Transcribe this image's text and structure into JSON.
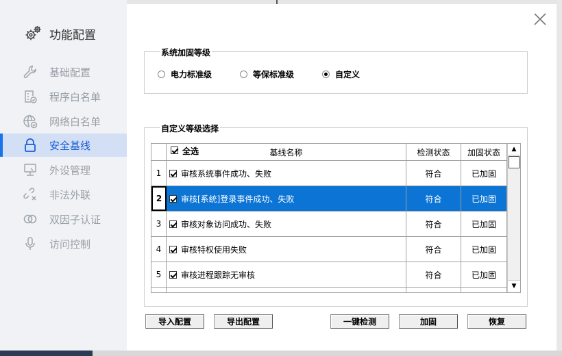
{
  "sidebar": {
    "title": "功能配置",
    "items": [
      {
        "label": "基础配置",
        "icon": "wrench-icon",
        "active": false
      },
      {
        "label": "程序白名单",
        "icon": "document-check-icon",
        "active": false
      },
      {
        "label": "网络白名单",
        "icon": "globe-check-icon",
        "active": false
      },
      {
        "label": "安全基线",
        "icon": "lock-icon",
        "active": true
      },
      {
        "label": "外设管理",
        "icon": "monitor-icon",
        "active": false
      },
      {
        "label": "非法外联",
        "icon": "broken-link-icon",
        "active": false
      },
      {
        "label": "双因子认证",
        "icon": "double-ring-icon",
        "active": false
      },
      {
        "label": "访问控制",
        "icon": "microphone-icon",
        "active": false
      }
    ]
  },
  "level_group": {
    "title": "系统加固等级",
    "options": [
      {
        "label": "电力标准级",
        "selected": false
      },
      {
        "label": "等保标准级",
        "selected": false
      },
      {
        "label": "自定义",
        "selected": true
      }
    ]
  },
  "custom_group": {
    "title": "自定义等级选择"
  },
  "table": {
    "select_all": "全选",
    "headers": {
      "name": "基线名称",
      "detect": "检测状态",
      "fix": "加固状态"
    },
    "rows": [
      {
        "num": "1",
        "name": "审核系统事件成功、失败",
        "detect": "符合",
        "fix": "已加固",
        "checked": true,
        "selected": false
      },
      {
        "num": "2",
        "name": "审核[系统]登录事件成功、失败",
        "detect": "符合",
        "fix": "已加固",
        "checked": true,
        "selected": true
      },
      {
        "num": "3",
        "name": "审核对象访问成功、失败",
        "detect": "符合",
        "fix": "已加固",
        "checked": true,
        "selected": false
      },
      {
        "num": "4",
        "name": "审核特权使用失败",
        "detect": "符合",
        "fix": "已加固",
        "checked": true,
        "selected": false
      },
      {
        "num": "5",
        "name": "审核进程跟踪无审核",
        "detect": "符合",
        "fix": "已加固",
        "checked": true,
        "selected": false
      }
    ]
  },
  "buttons": {
    "import": "导入配置",
    "export": "导出配置",
    "detect": "一键检测",
    "harden": "加固",
    "restore": "恢复"
  },
  "colors": {
    "accent": "#1a73e8",
    "row_selected": "#0b74d4",
    "sidebar_bg": "#f0f2f5",
    "sidebar_active": "#d3dff5"
  }
}
